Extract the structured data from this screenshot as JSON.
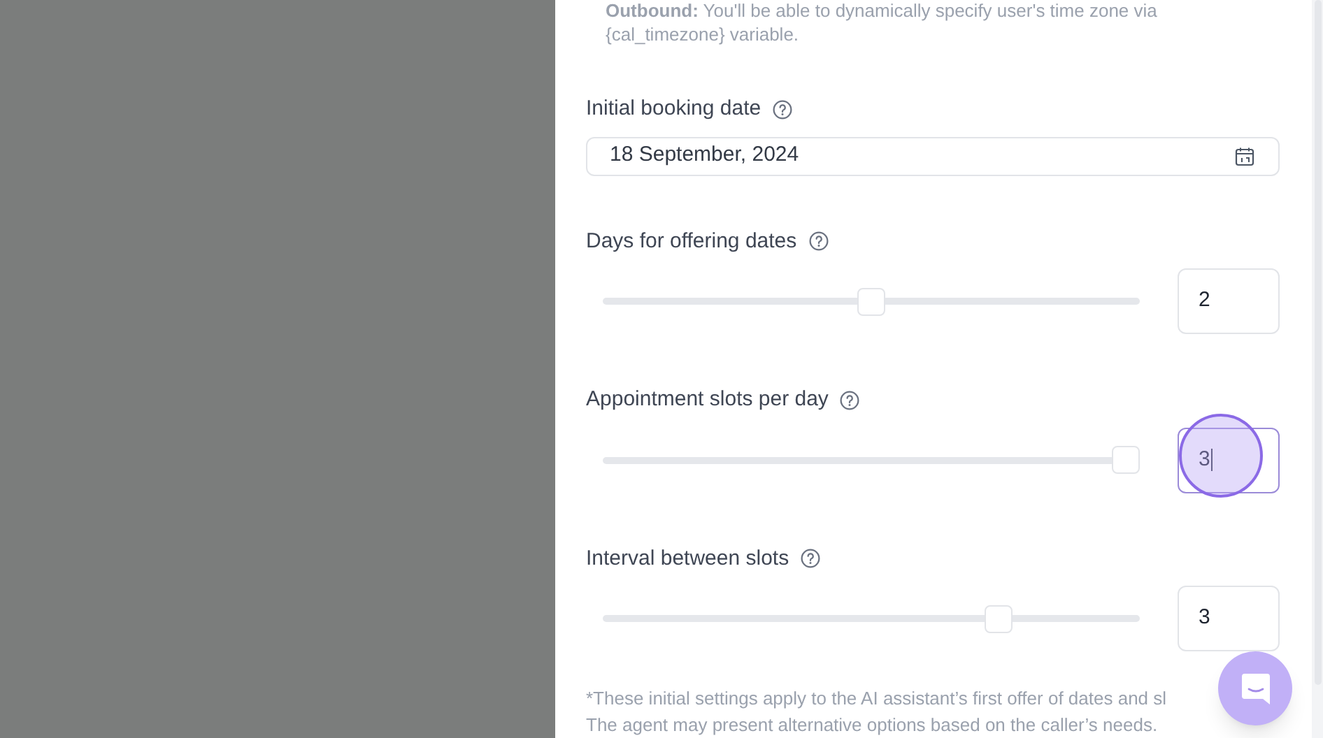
{
  "note_top": {
    "lines": [
      "**Outbound:** You'll be able to dynamically specify user's time zone via",
      "{cal_timezone} variable."
    ]
  },
  "date_field": {
    "label": "Initial booking date",
    "value": "18 September, 2024"
  },
  "sliders": [
    {
      "label": "Days for offering dates",
      "level": 0.5,
      "value": "2",
      "focused": false
    },
    {
      "label": "Appointment slots per day",
      "level": 1,
      "value": "3",
      "focused": true
    },
    {
      "label": "Interval between slots",
      "level": 0.75,
      "value": "3",
      "focused": false
    }
  ],
  "footnote": [
    "*These initial settings apply to the AI assistant’s first offer of dates and sl",
    "The agent may present alternative options based on the caller’s needs."
  ]
}
